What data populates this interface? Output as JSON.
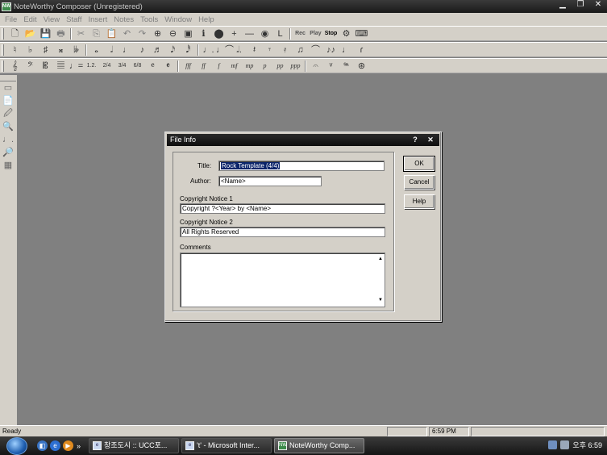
{
  "window": {
    "title": "NoteWorthy Composer (Unregistered)",
    "app_icon": "noteworthy-icon",
    "controls": [
      "minimize",
      "restore",
      "close"
    ]
  },
  "menu": [
    "File",
    "Edit",
    "View",
    "Staff",
    "Insert",
    "Notes",
    "Tools",
    "Window",
    "Help"
  ],
  "toolbar1": {
    "glyphs": [
      "🗋",
      "📂",
      "💾",
      "🖶",
      "✂",
      "⎘",
      "📋",
      "↶",
      "↷",
      "⊕",
      "⊖",
      "▣",
      "ℹ",
      "⬤",
      "+",
      "—",
      "◉",
      "L"
    ],
    "rec": "Rec",
    "play": "Play",
    "stop": "Stop"
  },
  "toolbar2": {
    "glyphs": [
      "♮",
      "♭",
      "♯",
      "𝄪",
      "𝄫",
      "𝅝",
      "𝅗𝅥",
      "♩",
      "♪",
      "♬",
      "𝅘𝅥𝅯",
      "𝅘𝅥𝅰",
      "♩.",
      "♩⌒",
      "𝅗𝅥.",
      "𝄽",
      "𝄾",
      "𝄿",
      "♫",
      "⌒",
      "♪♪",
      "♩",
      "ɾ"
    ]
  },
  "toolbar3": {
    "glyphs": [
      "𝄞",
      "𝄢",
      "𝄡",
      "𝄚",
      "♩=",
      "1.2.",
      "2/4",
      "3/4",
      "6/8",
      "𝄴",
      "𝄵"
    ],
    "dynamics": [
      "fff",
      "ff",
      "f",
      "mf",
      "mp",
      "p",
      "pp",
      "ppp"
    ],
    "extras": [
      "𝄐",
      "ᵛ",
      "𝆮",
      "⊛"
    ]
  },
  "left_tools": [
    "▭",
    "📄",
    "🖉",
    "🔍",
    "♩.",
    "🔎",
    "▦"
  ],
  "dialog": {
    "title": "File Info",
    "help_ctrl": "?",
    "close_ctrl": "✕",
    "title_label": "Title:",
    "title_value": "Rock Template (4/4)",
    "author_label": "Author:",
    "author_value": "<Name>",
    "copyright1_label": "Copyright Notice 1",
    "copyright1_value": "Copyright ?<Year> by <Name>",
    "copyright2_label": "Copyright Notice 2",
    "copyright2_value": "All Rights Reserved",
    "comments_label": "Comments",
    "ok": "OK",
    "cancel": "Cancel",
    "help": "Help"
  },
  "status": {
    "text": "Ready",
    "time": "6:59 PM"
  },
  "taskbar": {
    "tasks": [
      {
        "label": "창조도시 :: UCC포...",
        "icon": "ie-icon"
      },
      {
        "label": "'t' - Microsoft Inter...",
        "icon": "ie-icon"
      },
      {
        "label": "NoteWorthy Comp...",
        "icon": "noteworthy-icon"
      }
    ],
    "clock": "오후 6:59"
  }
}
